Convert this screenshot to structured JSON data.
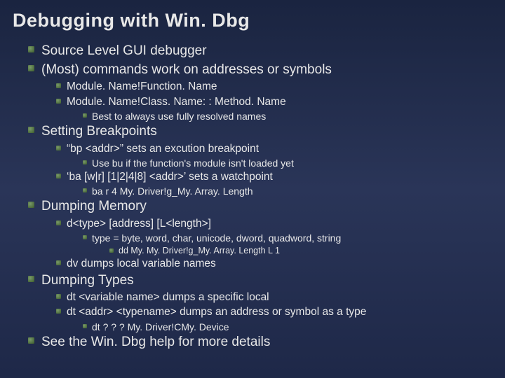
{
  "title": "Debugging with Win. Dbg",
  "items": [
    {
      "level": 1,
      "text": "Source Level GUI debugger"
    },
    {
      "level": 1,
      "text": "(Most) commands work on addresses or symbols"
    },
    {
      "level": 2,
      "text": "Module. Name!Function. Name"
    },
    {
      "level": 2,
      "text": "Module. Name!Class. Name: : Method. Name"
    },
    {
      "level": 3,
      "text": "Best to always use fully resolved names"
    },
    {
      "level": 1,
      "text": "Setting Breakpoints"
    },
    {
      "level": 2,
      "text": "“bp <addr>” sets an excution breakpoint"
    },
    {
      "level": 3,
      "text": "Use bu if the function's module isn't loaded yet"
    },
    {
      "level": 2,
      "text": "‘ba [w|r] [1|2|4|8] <addr>’ sets a watchpoint"
    },
    {
      "level": 3,
      "text": "ba r 4 My. Driver!g_My. Array. Length"
    },
    {
      "level": 1,
      "text": "Dumping Memory"
    },
    {
      "level": 2,
      "text": "d<type> [address] [L<length>]"
    },
    {
      "level": 3,
      "text": "type = byte, word, char, unicode, dword, quadword, string"
    },
    {
      "level": 4,
      "text": "dd My. My. Driver!g_My. Array. Length L 1"
    },
    {
      "level": 2,
      "text": "dv dumps local variable names"
    },
    {
      "level": 1,
      "text": "Dumping Types"
    },
    {
      "level": 2,
      "text": "dt <variable name> dumps a specific local"
    },
    {
      "level": 2,
      "text": "dt <addr> <typename> dumps an address or symbol as a type"
    },
    {
      "level": 3,
      "text": "dt ? ? ? My. Driver!CMy. Device"
    },
    {
      "level": 1,
      "text": "See the Win. Dbg help for more details"
    }
  ]
}
